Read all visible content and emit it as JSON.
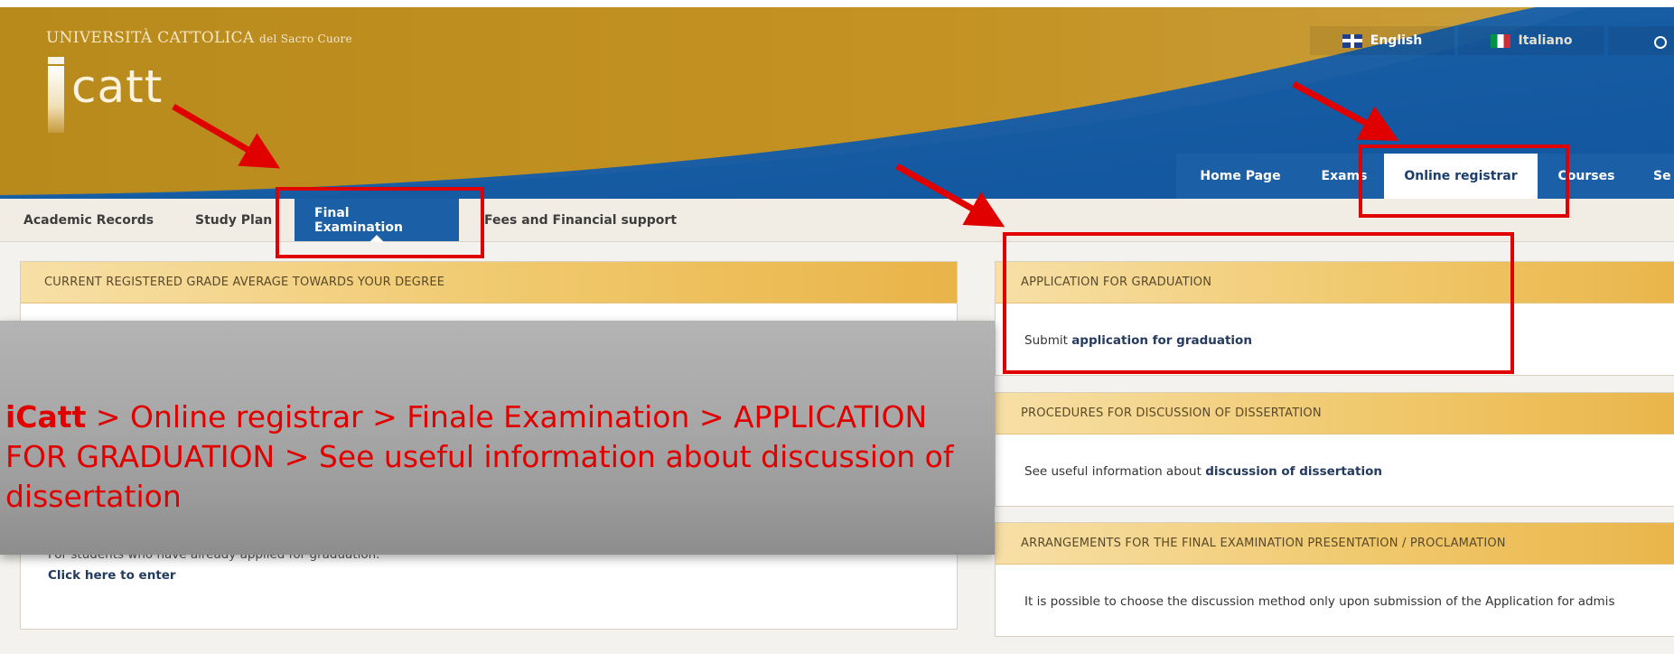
{
  "header": {
    "university_name": "UNIVERSITÀ CATTOLICA",
    "university_suffix": "del Sacro Cuore",
    "logo_text": "catt",
    "languages": [
      {
        "label": "English",
        "flag": "uk-flag-icon"
      },
      {
        "label": "Italiano",
        "flag": "italy-flag-icon"
      }
    ],
    "user_icon": "user-icon",
    "tabs": [
      {
        "label": "Home Page"
      },
      {
        "label": "Exams"
      },
      {
        "label": "Online registrar"
      },
      {
        "label": "Courses"
      },
      {
        "label": "Se"
      }
    ]
  },
  "subnav": {
    "tabs": [
      {
        "label": "Academic Records"
      },
      {
        "label": "Study Plan"
      },
      {
        "label": "Final Examination"
      },
      {
        "label": "Fees and Financial support"
      }
    ]
  },
  "left_panel": {
    "title": "CURRENT REGISTERED GRADE AVERAGE TOWARDS YOUR DEGREE",
    "partial_text": "For students who have already applied for graduation.",
    "link": "Click here to enter"
  },
  "right_panels": [
    {
      "title": "APPLICATION FOR GRADUATION",
      "text": "Submit",
      "bold": "application for graduation"
    },
    {
      "title": "PROCEDURES FOR DISCUSSION OF DISSERTATION",
      "text": "See useful information about",
      "bold": "discussion of dissertation"
    },
    {
      "title": "ARRANGEMENTS FOR THE FINAL EXAMINATION PRESENTATION / PROCLAMATION",
      "text": "It is possible to choose the discussion method only upon submission of the Application for admis",
      "bold": ""
    }
  ],
  "overlay": {
    "brand": "iCatt",
    "path": " > Online registrar > Finale Examination > APPLICATION FOR GRADUATION > See useful information about discussion of dissertation"
  },
  "colors": {
    "header_gold": "#c0911f",
    "header_blue": "#1b5fa6",
    "annotation_red": "#e00000",
    "panel_header": "#f0c86b"
  }
}
